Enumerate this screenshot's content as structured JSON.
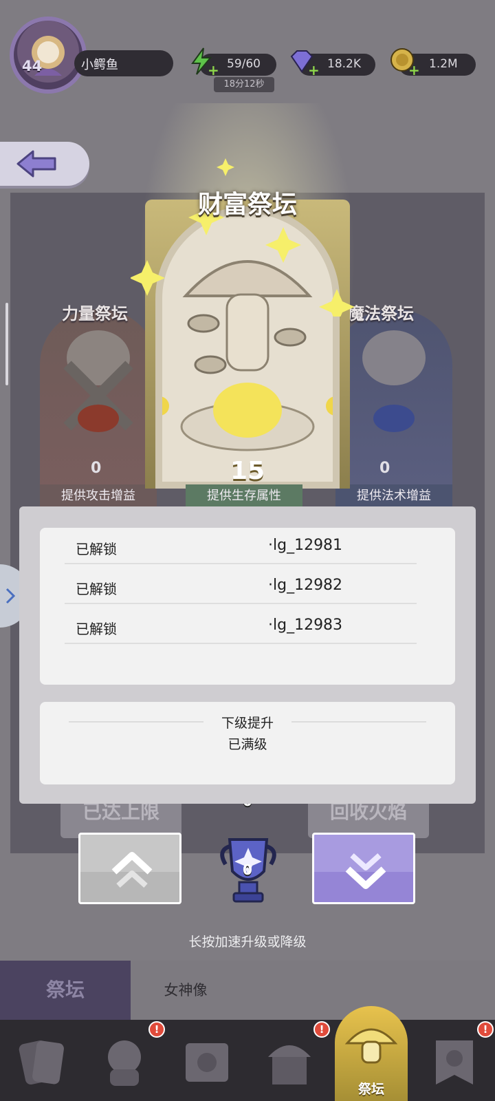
{
  "player": {
    "level": "44",
    "name": "小鳄鱼"
  },
  "resources": {
    "energy": {
      "value": "59/60",
      "timer": "18分12秒",
      "icon": "lightning-icon"
    },
    "gems": {
      "value": "18.2K",
      "icon": "gem-icon"
    },
    "coins": {
      "value": "1.2M",
      "icon": "coin-icon"
    }
  },
  "altars": {
    "left": {
      "title": "力量祭坛",
      "count": "0",
      "desc": "提供攻击增益"
    },
    "center": {
      "title": "财富祭坛",
      "level": "15",
      "desc": "提供生存属性"
    },
    "right": {
      "title": "魔法祭坛",
      "count": "0",
      "desc": "提供法术增益"
    }
  },
  "unlocks": [
    {
      "status": "已解锁",
      "item": "·lg_12981"
    },
    {
      "status": "已解锁",
      "item": "·lg_12982"
    },
    {
      "status": "已解锁",
      "item": "·lg_12983"
    }
  ],
  "next_level": {
    "title": "下级提升",
    "value": "已满级"
  },
  "ghost_buttons": {
    "limit": "已达上限",
    "recycle": "回收火焰"
  },
  "trophy": {
    "count": "0",
    "count_back": "0"
  },
  "hint": "长按加速升级或降级",
  "tabs": {
    "active": "祭坛",
    "other": "女神像"
  },
  "bottom_nav": {
    "active_label": "祭坛",
    "badge": "!"
  },
  "colors": {
    "accent_purple": "#9585d6",
    "gold": "#e7c24d",
    "badge_red": "#e04b3b"
  }
}
